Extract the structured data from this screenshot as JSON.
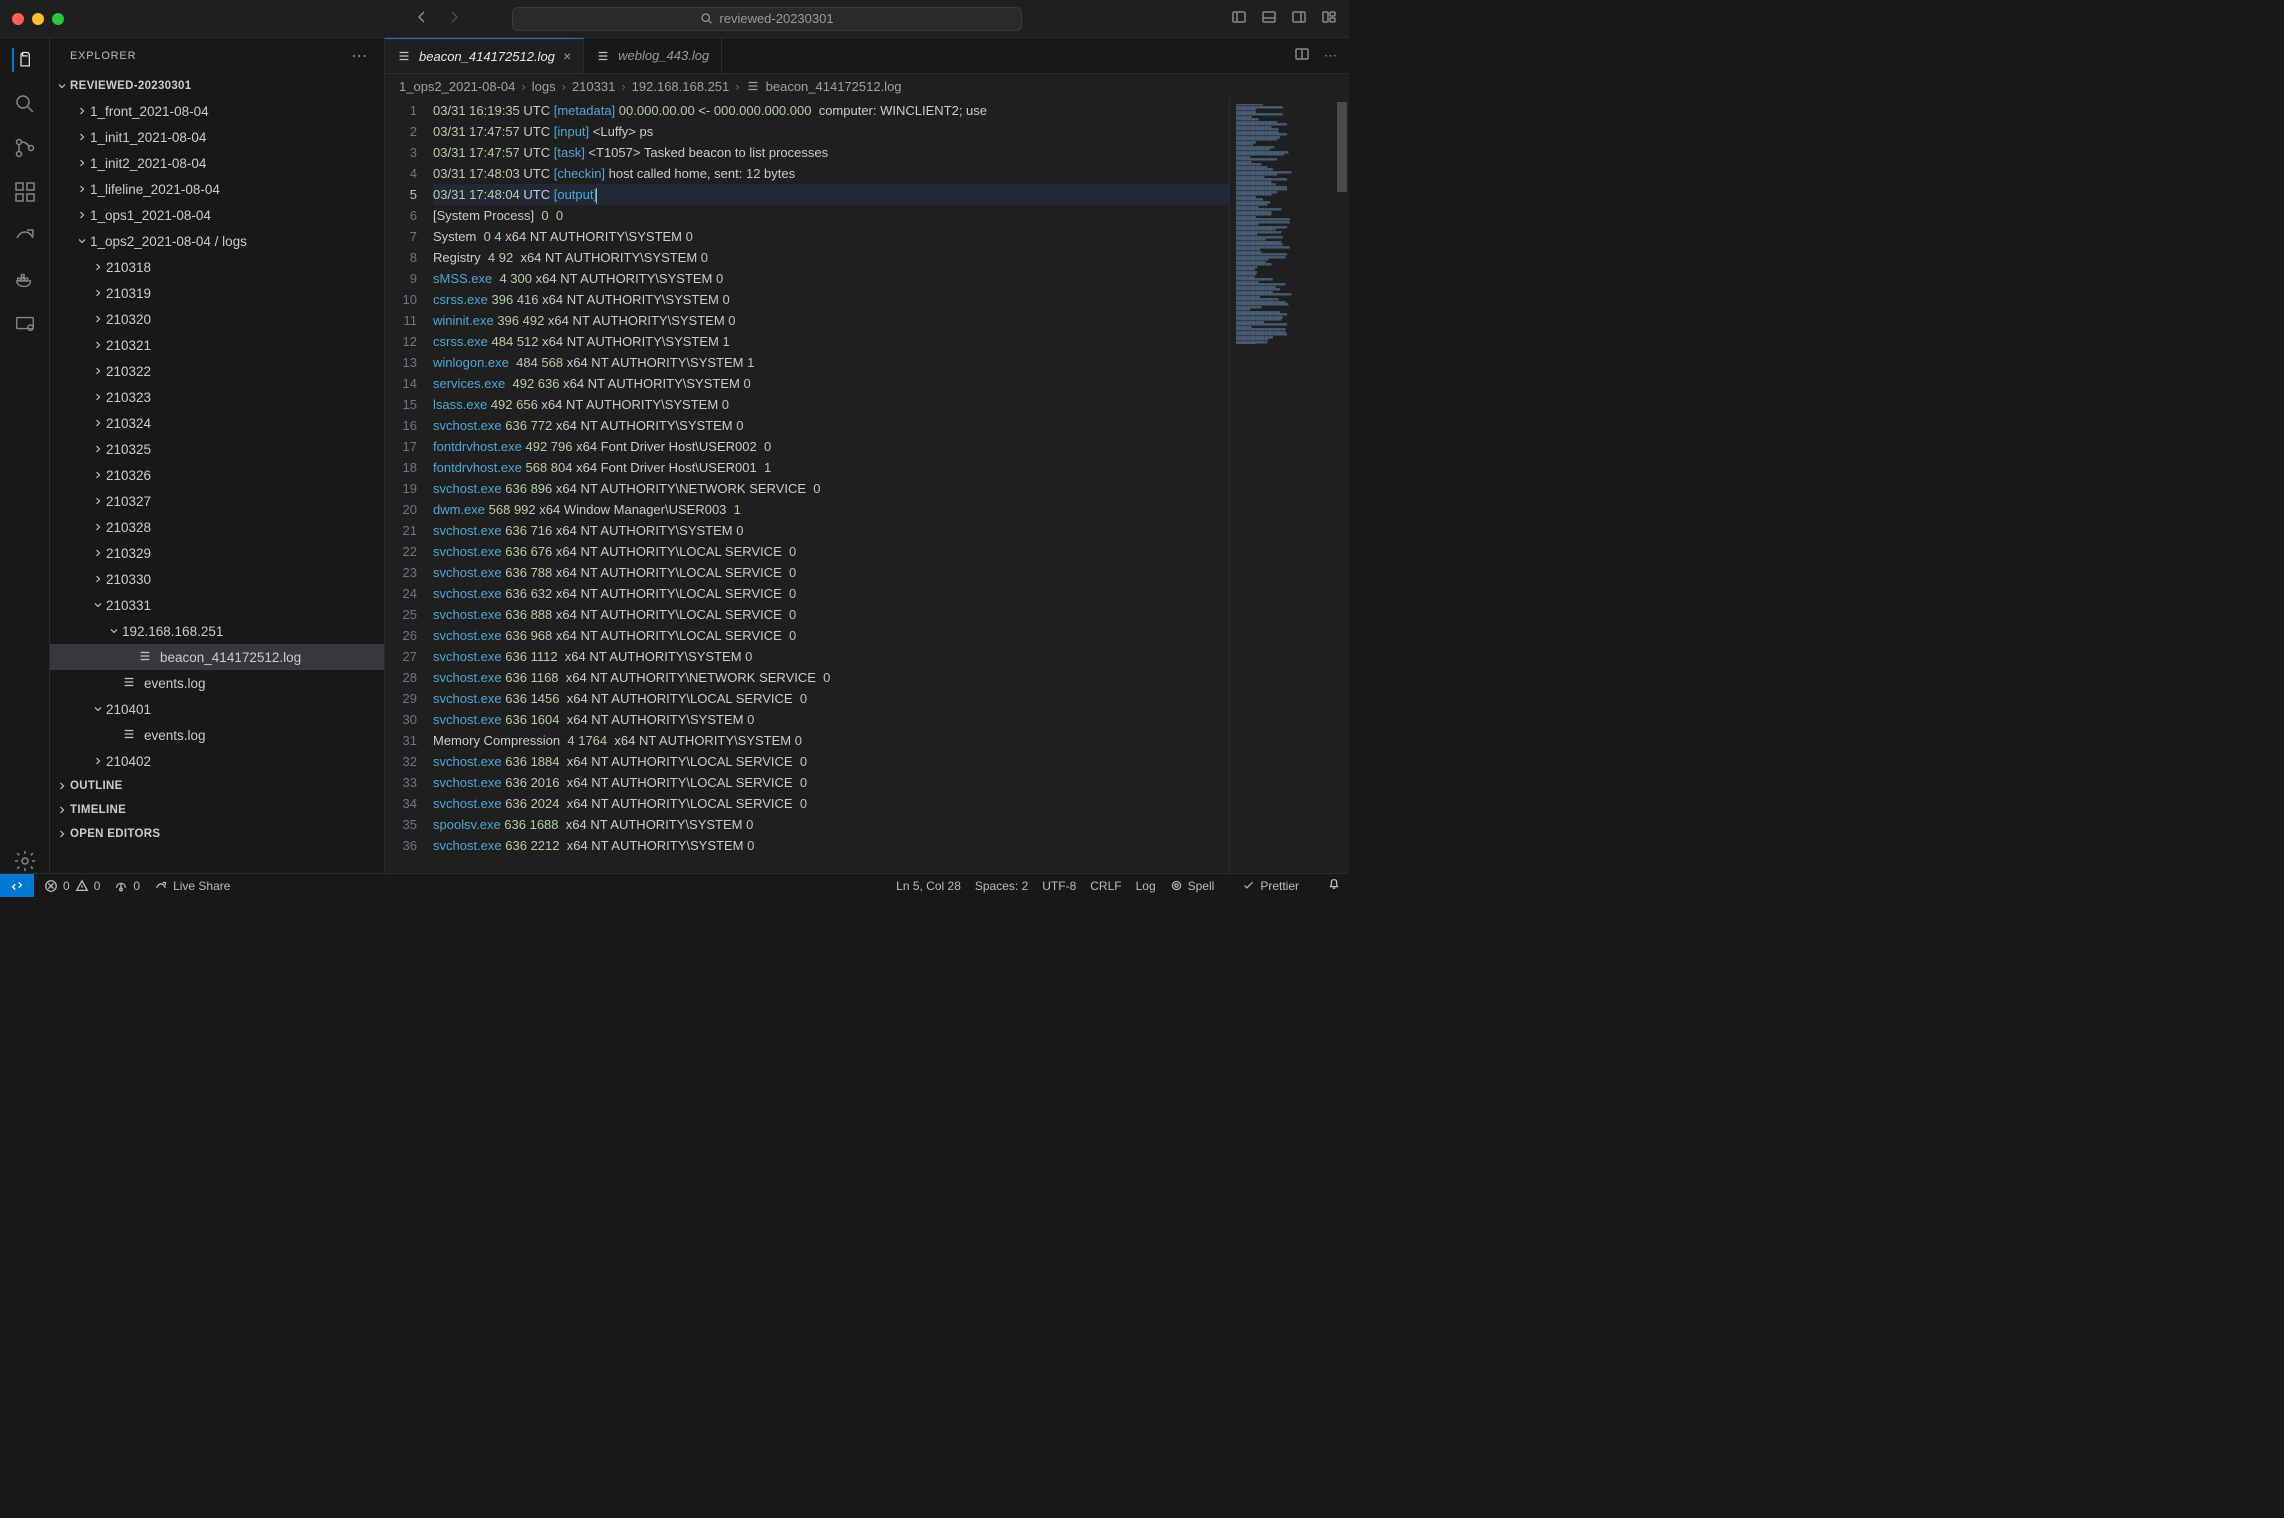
{
  "titlebar": {
    "search_placeholder": "reviewed-20230301"
  },
  "sidebar": {
    "title": "EXPLORER",
    "workspace": "REVIEWED-20230301",
    "folders": [
      {
        "name": "1_front_2021-08-04",
        "depth": 1,
        "open": false
      },
      {
        "name": "1_init1_2021-08-04",
        "depth": 1,
        "open": false
      },
      {
        "name": "1_init2_2021-08-04",
        "depth": 1,
        "open": false
      },
      {
        "name": "1_lifeline_2021-08-04",
        "depth": 1,
        "open": false
      },
      {
        "name": "1_ops1_2021-08-04",
        "depth": 1,
        "open": false
      },
      {
        "name": "1_ops2_2021-08-04 / logs",
        "depth": 1,
        "open": true
      },
      {
        "name": "210318",
        "depth": 2,
        "open": false
      },
      {
        "name": "210319",
        "depth": 2,
        "open": false
      },
      {
        "name": "210320",
        "depth": 2,
        "open": false
      },
      {
        "name": "210321",
        "depth": 2,
        "open": false
      },
      {
        "name": "210322",
        "depth": 2,
        "open": false
      },
      {
        "name": "210323",
        "depth": 2,
        "open": false
      },
      {
        "name": "210324",
        "depth": 2,
        "open": false
      },
      {
        "name": "210325",
        "depth": 2,
        "open": false
      },
      {
        "name": "210326",
        "depth": 2,
        "open": false
      },
      {
        "name": "210327",
        "depth": 2,
        "open": false
      },
      {
        "name": "210328",
        "depth": 2,
        "open": false
      },
      {
        "name": "210329",
        "depth": 2,
        "open": false
      },
      {
        "name": "210330",
        "depth": 2,
        "open": false
      },
      {
        "name": "210331",
        "depth": 2,
        "open": true
      },
      {
        "name": "192.168.168.251",
        "depth": 3,
        "open": true
      },
      {
        "name": "beacon_414172512.log",
        "depth": 4,
        "file": true,
        "selected": true
      },
      {
        "name": "events.log",
        "depth": 3,
        "file": true
      },
      {
        "name": "210401",
        "depth": 2,
        "open": true
      },
      {
        "name": "events.log",
        "depth": 3,
        "file": true
      },
      {
        "name": "210402",
        "depth": 2,
        "open": false
      }
    ],
    "sections": [
      "OUTLINE",
      "TIMELINE",
      "OPEN EDITORS"
    ]
  },
  "tabs": [
    {
      "label": "beacon_414172512.log",
      "active": true,
      "close": true
    },
    {
      "label": "weblog_443.log",
      "active": false,
      "close": false
    }
  ],
  "breadcrumb": [
    "1_ops2_2021-08-04",
    "logs",
    "210331",
    "192.168.168.251",
    "beacon_414172512.log"
  ],
  "editor": {
    "active_line": 5,
    "lines": [
      {
        "n": 1,
        "seg": [
          [
            "03",
            "c-num"
          ],
          [
            "/",
            "c-light"
          ],
          [
            "31 ",
            "c-num"
          ],
          [
            "16:19:35 ",
            "c-num"
          ],
          [
            "UTC ",
            "c-light"
          ],
          [
            "[metadata] ",
            "c-blue"
          ],
          [
            "00.000.00.00 ",
            "c-num"
          ],
          [
            "<- ",
            "c-light"
          ],
          [
            "000.000.000.000",
            "c-num"
          ],
          [
            "  computer: WINCLIENT2; use",
            "c-light"
          ]
        ]
      },
      {
        "n": 2,
        "seg": [
          [
            "03",
            "c-num"
          ],
          [
            "/",
            "c-light"
          ],
          [
            "31 ",
            "c-num"
          ],
          [
            "17:47:57 ",
            "c-num"
          ],
          [
            "UTC ",
            "c-light"
          ],
          [
            "[input] ",
            "c-blue"
          ],
          [
            "<Luffy> ps",
            "c-light"
          ]
        ]
      },
      {
        "n": 3,
        "seg": [
          [
            "03",
            "c-num"
          ],
          [
            "/",
            "c-light"
          ],
          [
            "31 ",
            "c-num"
          ],
          [
            "17:47:57 ",
            "c-num"
          ],
          [
            "UTC ",
            "c-light"
          ],
          [
            "[task] ",
            "c-blue"
          ],
          [
            "<T1057> Tasked beacon to list processes",
            "c-light"
          ]
        ]
      },
      {
        "n": 4,
        "seg": [
          [
            "03",
            "c-num"
          ],
          [
            "/",
            "c-light"
          ],
          [
            "31 ",
            "c-num"
          ],
          [
            "17:48:03 ",
            "c-num"
          ],
          [
            "UTC ",
            "c-light"
          ],
          [
            "[checkin] ",
            "c-blue"
          ],
          [
            "host called home, sent: ",
            "c-light"
          ],
          [
            "12 ",
            "c-num"
          ],
          [
            "bytes",
            "c-light"
          ]
        ]
      },
      {
        "n": 5,
        "seg": [
          [
            "03",
            "c-num"
          ],
          [
            "/",
            "c-light"
          ],
          [
            "31 ",
            "c-num"
          ],
          [
            "17:48:04 ",
            "c-num"
          ],
          [
            "UTC ",
            "c-light"
          ],
          [
            "[output]",
            "c-blue"
          ]
        ],
        "cursor": true,
        "highlight": true
      },
      {
        "n": 6,
        "seg": [
          [
            "[System Process]  ",
            "c-light"
          ],
          [
            "0  0",
            "c-num"
          ]
        ]
      },
      {
        "n": 7,
        "seg": [
          [
            "System  ",
            "c-light"
          ],
          [
            "0 4 ",
            "c-num"
          ],
          [
            "x64 NT AUTHORITY\\SYSTEM ",
            "c-light"
          ],
          [
            "0",
            "c-num"
          ]
        ]
      },
      {
        "n": 8,
        "seg": [
          [
            "Registry  ",
            "c-light"
          ],
          [
            "4 92  ",
            "c-num"
          ],
          [
            "x64 NT AUTHORITY\\SYSTEM ",
            "c-light"
          ],
          [
            "0",
            "c-num"
          ]
        ]
      },
      {
        "n": 9,
        "seg": [
          [
            "sMSS.exe  ",
            "c-blue"
          ],
          [
            "4 300 ",
            "c-num"
          ],
          [
            "x64 NT AUTHORITY\\SYSTEM ",
            "c-light"
          ],
          [
            "0",
            "c-num"
          ]
        ]
      },
      {
        "n": 10,
        "seg": [
          [
            "csrss.exe ",
            "c-blue"
          ],
          [
            "396 416 ",
            "c-num"
          ],
          [
            "x64 NT AUTHORITY\\SYSTEM ",
            "c-light"
          ],
          [
            "0",
            "c-num"
          ]
        ]
      },
      {
        "n": 11,
        "seg": [
          [
            "wininit.exe ",
            "c-blue"
          ],
          [
            "396 492 ",
            "c-num"
          ],
          [
            "x64 NT AUTHORITY\\SYSTEM ",
            "c-light"
          ],
          [
            "0",
            "c-num"
          ]
        ]
      },
      {
        "n": 12,
        "seg": [
          [
            "csrss.exe ",
            "c-blue"
          ],
          [
            "484 512 ",
            "c-num"
          ],
          [
            "x64 NT AUTHORITY\\SYSTEM ",
            "c-light"
          ],
          [
            "1",
            "c-num"
          ]
        ]
      },
      {
        "n": 13,
        "seg": [
          [
            "winlogon.exe  ",
            "c-blue"
          ],
          [
            "484 568 ",
            "c-num"
          ],
          [
            "x64 NT AUTHORITY\\SYSTEM ",
            "c-light"
          ],
          [
            "1",
            "c-num"
          ]
        ]
      },
      {
        "n": 14,
        "seg": [
          [
            "services.exe  ",
            "c-blue"
          ],
          [
            "492 636 ",
            "c-num"
          ],
          [
            "x64 NT AUTHORITY\\SYSTEM ",
            "c-light"
          ],
          [
            "0",
            "c-num"
          ]
        ]
      },
      {
        "n": 15,
        "seg": [
          [
            "lsass.exe ",
            "c-blue"
          ],
          [
            "492 656 ",
            "c-num"
          ],
          [
            "x64 NT AUTHORITY\\SYSTEM ",
            "c-light"
          ],
          [
            "0",
            "c-num"
          ]
        ]
      },
      {
        "n": 16,
        "seg": [
          [
            "svchost.exe ",
            "c-blue"
          ],
          [
            "636 772 ",
            "c-num"
          ],
          [
            "x64 NT AUTHORITY\\SYSTEM ",
            "c-light"
          ],
          [
            "0",
            "c-num"
          ]
        ]
      },
      {
        "n": 17,
        "seg": [
          [
            "fontdrvhost.exe ",
            "c-blue"
          ],
          [
            "492 796 ",
            "c-num"
          ],
          [
            "x64 Font Driver Host\\USER002  ",
            "c-light"
          ],
          [
            "0",
            "c-num"
          ]
        ]
      },
      {
        "n": 18,
        "seg": [
          [
            "fontdrvhost.exe ",
            "c-blue"
          ],
          [
            "568 804 ",
            "c-num"
          ],
          [
            "x64 Font Driver Host\\USER001  ",
            "c-light"
          ],
          [
            "1",
            "c-num"
          ]
        ]
      },
      {
        "n": 19,
        "seg": [
          [
            "svchost.exe ",
            "c-blue"
          ],
          [
            "636 896 ",
            "c-num"
          ],
          [
            "x64 NT AUTHORITY\\NETWORK SERVICE  ",
            "c-light"
          ],
          [
            "0",
            "c-num"
          ]
        ]
      },
      {
        "n": 20,
        "seg": [
          [
            "dwm.exe ",
            "c-blue"
          ],
          [
            "568 992 ",
            "c-num"
          ],
          [
            "x64 Window Manager\\USER003  ",
            "c-light"
          ],
          [
            "1",
            "c-num"
          ]
        ]
      },
      {
        "n": 21,
        "seg": [
          [
            "svchost.exe ",
            "c-blue"
          ],
          [
            "636 716 ",
            "c-num"
          ],
          [
            "x64 NT AUTHORITY\\SYSTEM ",
            "c-light"
          ],
          [
            "0",
            "c-num"
          ]
        ]
      },
      {
        "n": 22,
        "seg": [
          [
            "svchost.exe ",
            "c-blue"
          ],
          [
            "636 676 ",
            "c-num"
          ],
          [
            "x64 NT AUTHORITY\\LOCAL SERVICE  ",
            "c-light"
          ],
          [
            "0",
            "c-num"
          ]
        ]
      },
      {
        "n": 23,
        "seg": [
          [
            "svchost.exe ",
            "c-blue"
          ],
          [
            "636 788 ",
            "c-num"
          ],
          [
            "x64 NT AUTHORITY\\LOCAL SERVICE  ",
            "c-light"
          ],
          [
            "0",
            "c-num"
          ]
        ]
      },
      {
        "n": 24,
        "seg": [
          [
            "svchost.exe ",
            "c-blue"
          ],
          [
            "636 632 ",
            "c-num"
          ],
          [
            "x64 NT AUTHORITY\\LOCAL SERVICE  ",
            "c-light"
          ],
          [
            "0",
            "c-num"
          ]
        ]
      },
      {
        "n": 25,
        "seg": [
          [
            "svchost.exe ",
            "c-blue"
          ],
          [
            "636 888 ",
            "c-num"
          ],
          [
            "x64 NT AUTHORITY\\LOCAL SERVICE  ",
            "c-light"
          ],
          [
            "0",
            "c-num"
          ]
        ]
      },
      {
        "n": 26,
        "seg": [
          [
            "svchost.exe ",
            "c-blue"
          ],
          [
            "636 968 ",
            "c-num"
          ],
          [
            "x64 NT AUTHORITY\\LOCAL SERVICE  ",
            "c-light"
          ],
          [
            "0",
            "c-num"
          ]
        ]
      },
      {
        "n": 27,
        "seg": [
          [
            "svchost.exe ",
            "c-blue"
          ],
          [
            "636 1112  ",
            "c-num"
          ],
          [
            "x64 NT AUTHORITY\\SYSTEM ",
            "c-light"
          ],
          [
            "0",
            "c-num"
          ]
        ]
      },
      {
        "n": 28,
        "seg": [
          [
            "svchost.exe ",
            "c-blue"
          ],
          [
            "636 1168  ",
            "c-num"
          ],
          [
            "x64 NT AUTHORITY\\NETWORK SERVICE  ",
            "c-light"
          ],
          [
            "0",
            "c-num"
          ]
        ]
      },
      {
        "n": 29,
        "seg": [
          [
            "svchost.exe ",
            "c-blue"
          ],
          [
            "636 1456  ",
            "c-num"
          ],
          [
            "x64 NT AUTHORITY\\LOCAL SERVICE  ",
            "c-light"
          ],
          [
            "0",
            "c-num"
          ]
        ]
      },
      {
        "n": 30,
        "seg": [
          [
            "svchost.exe ",
            "c-blue"
          ],
          [
            "636 1604  ",
            "c-num"
          ],
          [
            "x64 NT AUTHORITY\\SYSTEM ",
            "c-light"
          ],
          [
            "0",
            "c-num"
          ]
        ]
      },
      {
        "n": 31,
        "seg": [
          [
            "Memory Compression  ",
            "c-light"
          ],
          [
            "4 1764  ",
            "c-num"
          ],
          [
            "x64 NT AUTHORITY\\SYSTEM ",
            "c-light"
          ],
          [
            "0",
            "c-num"
          ]
        ]
      },
      {
        "n": 32,
        "seg": [
          [
            "svchost.exe ",
            "c-blue"
          ],
          [
            "636 1884  ",
            "c-num"
          ],
          [
            "x64 NT AUTHORITY\\LOCAL SERVICE  ",
            "c-light"
          ],
          [
            "0",
            "c-num"
          ]
        ]
      },
      {
        "n": 33,
        "seg": [
          [
            "svchost.exe ",
            "c-blue"
          ],
          [
            "636 2016  ",
            "c-num"
          ],
          [
            "x64 NT AUTHORITY\\LOCAL SERVICE  ",
            "c-light"
          ],
          [
            "0",
            "c-num"
          ]
        ]
      },
      {
        "n": 34,
        "seg": [
          [
            "svchost.exe ",
            "c-blue"
          ],
          [
            "636 2024  ",
            "c-num"
          ],
          [
            "x64 NT AUTHORITY\\LOCAL SERVICE  ",
            "c-light"
          ],
          [
            "0",
            "c-num"
          ]
        ]
      },
      {
        "n": 35,
        "seg": [
          [
            "spoolsv.exe ",
            "c-blue"
          ],
          [
            "636 1688  ",
            "c-num"
          ],
          [
            "x64 NT AUTHORITY\\SYSTEM ",
            "c-light"
          ],
          [
            "0",
            "c-num"
          ]
        ]
      },
      {
        "n": 36,
        "seg": [
          [
            "svchost.exe ",
            "c-blue"
          ],
          [
            "636 2212  ",
            "c-num"
          ],
          [
            "x64 NT AUTHORITY\\SYSTEM ",
            "c-light"
          ],
          [
            "0",
            "c-num"
          ]
        ]
      }
    ]
  },
  "statusbar": {
    "errors": "0",
    "warnings": "0",
    "ports": "0",
    "liveshare": "Live Share",
    "position": "Ln 5, Col 28",
    "spaces": "Spaces: 2",
    "encoding": "UTF-8",
    "eol": "CRLF",
    "lang": "Log",
    "spell": "Spell",
    "prettier": "Prettier"
  }
}
